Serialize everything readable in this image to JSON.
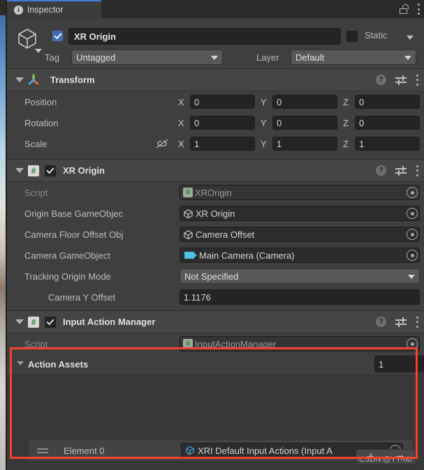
{
  "window": {
    "tab_label": "Inspector",
    "tab_icon": "info-icon",
    "lock_icon": "unlocked-padlock-icon",
    "menu_icon": "kebab-menu-icon"
  },
  "gameobject": {
    "icon": "cube-icon",
    "enabled": true,
    "name": "XR Origin",
    "static_label": "Static",
    "static_checked": false,
    "tag_label": "Tag",
    "tag_value": "Untagged",
    "layer_label": "Layer",
    "layer_value": "Default"
  },
  "transform": {
    "title": "Transform",
    "icon": "transform-gizmo-icon",
    "rows": [
      {
        "label": "Position",
        "x": "0",
        "y": "0",
        "z": "0"
      },
      {
        "label": "Rotation",
        "x": "0",
        "y": "0",
        "z": "0"
      },
      {
        "label": "Scale",
        "x": "1",
        "y": "1",
        "z": "1"
      }
    ],
    "axis_x": "X",
    "axis_y": "Y",
    "axis_z": "Z",
    "constrain_icon": "link-broken-icon",
    "help_icon": "help-icon",
    "preset_icon": "preset-settings-icon",
    "menu_icon": "kebab-menu-icon"
  },
  "xr_origin": {
    "title": "XR Origin",
    "enabled": true,
    "script_icon": "script-icon",
    "fields": [
      {
        "label": "Script",
        "value": "XROrigin",
        "icon": "script-asset-icon",
        "dim": true
      },
      {
        "label": "Origin Base GameObjec",
        "value": "XR Origin",
        "icon": "gameobject-cube-icon",
        "dim": false
      },
      {
        "label": "Camera Floor Offset Obj",
        "value": "Camera Offset",
        "icon": "gameobject-cube-icon",
        "dim": false
      },
      {
        "label": "Camera GameObject",
        "value": "Main Camera (Camera)",
        "icon": "camera-icon",
        "dim": false
      }
    ],
    "tracking_label": "Tracking Origin Mode",
    "tracking_value": "Not Specified",
    "camera_y_label": "Camera Y Offset",
    "camera_y_value": "1.1176"
  },
  "input_action_manager": {
    "title": "Input Action Manager",
    "enabled": true,
    "script_label": "Script",
    "script_value": "InputActionManager",
    "action_assets_label": "Action Assets",
    "array_size": "1",
    "element_label": "Element 0",
    "element_value": "XRI Default Input Actions (Input A",
    "element_icon": "input-actions-asset-icon",
    "add_label": "+",
    "remove_label": "−"
  },
  "watermark": "CSDN @YY-nb",
  "colors": {
    "panel_bg": "#383838",
    "component_bg": "#3f3f3f",
    "header_bg": "#454545",
    "tab_bg": "#3c3c3c",
    "tab_accent": "#3f7fd6",
    "field_bg": "#242424",
    "dropdown_bg": "#585858",
    "highlight_red": "#f4422e",
    "checkbox_blue": "#3d6bb0"
  }
}
